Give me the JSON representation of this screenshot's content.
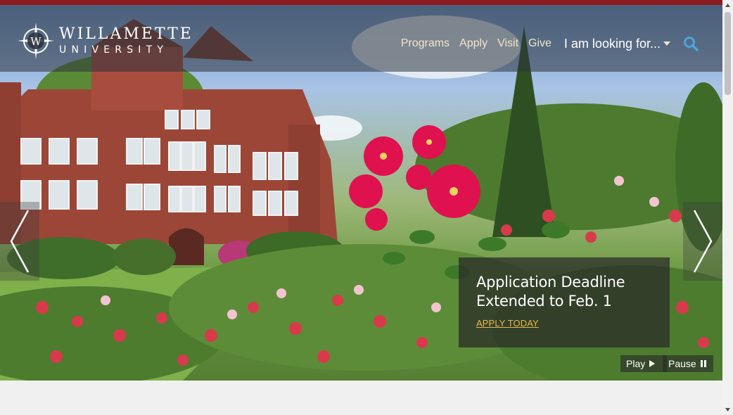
{
  "brand": {
    "line1": "WILLAMETTE",
    "line2": "UNIVERSITY",
    "mark_letter": "W",
    "accent_color": "#8b1a1f",
    "gold_color": "#e8b84a"
  },
  "nav": {
    "items": [
      {
        "label": "Programs"
      },
      {
        "label": "Apply"
      },
      {
        "label": "Visit"
      },
      {
        "label": "Give"
      }
    ],
    "looking_for": "I am looking for...",
    "search_icon": "search-icon"
  },
  "hero": {
    "caption_title": "Application Deadline Extended to Feb. 1",
    "caption_link": "APPLY TODAY",
    "prev_icon": "chevron-left-icon",
    "next_icon": "chevron-right-icon"
  },
  "slideshow_controls": {
    "play_label": "Play",
    "pause_label": "Pause"
  }
}
